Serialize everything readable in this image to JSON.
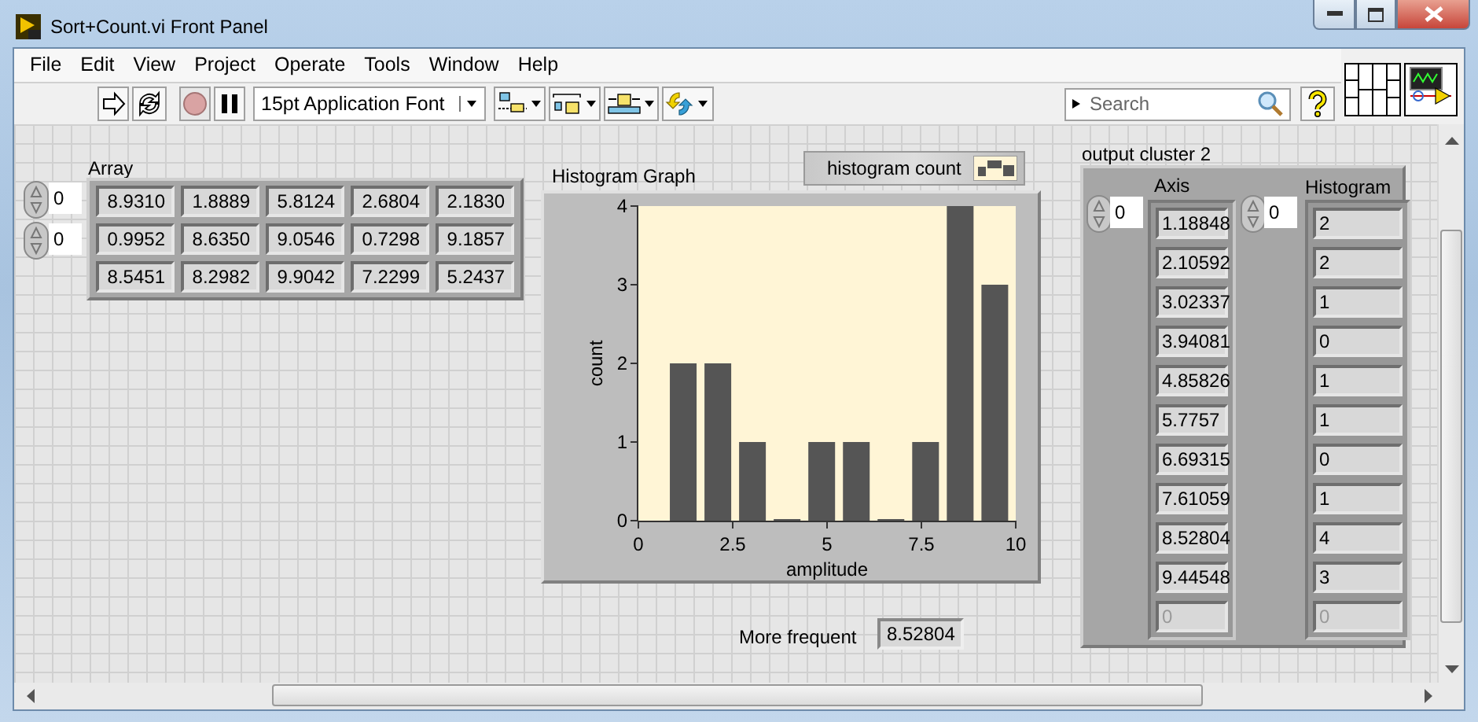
{
  "window": {
    "title": "Sort+Count.vi Front Panel"
  },
  "menu": [
    "File",
    "Edit",
    "View",
    "Project",
    "Operate",
    "Tools",
    "Window",
    "Help"
  ],
  "toolbar": {
    "font": "15pt Application Font",
    "search": {
      "placeholder": "Search"
    }
  },
  "array": {
    "label": "Array",
    "indices": [
      "0",
      "0"
    ],
    "rows": [
      [
        "8.9310",
        "1.8889",
        "5.8124",
        "2.6804",
        "2.1830"
      ],
      [
        "0.9952",
        "8.6350",
        "9.0546",
        "0.7298",
        "9.1857"
      ],
      [
        "8.5451",
        "8.2982",
        "9.9042",
        "7.2299",
        "5.2437"
      ]
    ]
  },
  "graph": {
    "label": "Histogram Graph",
    "chart_data": {
      "type": "bar",
      "xlabel": "amplitude",
      "ylabel": "count",
      "x": [
        1.18848,
        2.10592,
        3.02337,
        3.94081,
        4.85826,
        5.7757,
        6.69315,
        7.61059,
        8.52804,
        9.44548
      ],
      "series": [
        {
          "name": "histogram count",
          "color": "#555555",
          "values": [
            2,
            2,
            1,
            0,
            1,
            1,
            0,
            1,
            4,
            3
          ]
        }
      ],
      "xlim": [
        0,
        10
      ],
      "ylim": [
        0,
        4
      ],
      "xticks": [
        0,
        2.5,
        5,
        7.5,
        10
      ],
      "yticks": [
        0,
        1,
        2,
        3,
        4
      ]
    }
  },
  "more_frequent": {
    "label": "More frequent",
    "value": "8.52804"
  },
  "cluster": {
    "label": "output cluster 2",
    "columns": [
      {
        "label": "Axis",
        "index": "0",
        "cells": [
          {
            "text": "1.18848",
            "disabled": false
          },
          {
            "text": "2.10592",
            "disabled": false
          },
          {
            "text": "3.02337",
            "disabled": false
          },
          {
            "text": "3.94081",
            "disabled": false
          },
          {
            "text": "4.85826",
            "disabled": false
          },
          {
            "text": "5.7757",
            "disabled": false
          },
          {
            "text": "6.69315",
            "disabled": false
          },
          {
            "text": "7.61059",
            "disabled": false
          },
          {
            "text": "8.52804",
            "disabled": false
          },
          {
            "text": "9.44548",
            "disabled": false
          },
          {
            "text": "0",
            "disabled": true
          }
        ]
      },
      {
        "label": "Histogram",
        "index": "0",
        "cells": [
          {
            "text": "2",
            "disabled": false
          },
          {
            "text": "2",
            "disabled": false
          },
          {
            "text": "1",
            "disabled": false
          },
          {
            "text": "0",
            "disabled": false
          },
          {
            "text": "1",
            "disabled": false
          },
          {
            "text": "1",
            "disabled": false
          },
          {
            "text": "0",
            "disabled": false
          },
          {
            "text": "1",
            "disabled": false
          },
          {
            "text": "4",
            "disabled": false
          },
          {
            "text": "3",
            "disabled": false
          },
          {
            "text": "0",
            "disabled": true
          }
        ]
      }
    ]
  }
}
